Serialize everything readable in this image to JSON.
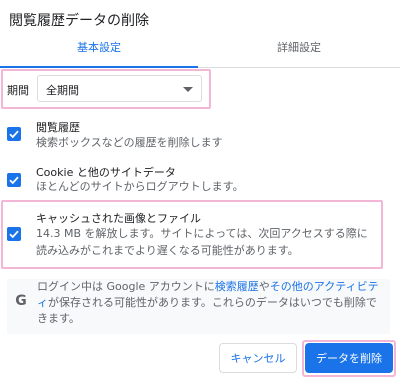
{
  "dialog": {
    "title": "閲覧履歴データの削除"
  },
  "tabs": [
    {
      "label": "基本設定",
      "active": true
    },
    {
      "label": "詳細設定",
      "active": false
    }
  ],
  "period": {
    "label": "期間",
    "selected": "全期間"
  },
  "options": [
    {
      "title": "閲覧履歴",
      "description": "検索ボックスなどの履歴を削除します",
      "checked": true
    },
    {
      "title": "Cookie と他のサイトデータ",
      "description": "ほとんどのサイトからログアウトします。",
      "checked": true
    },
    {
      "title": "キャッシュされた画像とファイル",
      "description": "14.3 MB を解放します。サイトによっては、次回アクセスする際に読み込みがこれまでより遅くなる可能性があります。",
      "checked": true
    }
  ],
  "info": {
    "icon": "google-g-icon",
    "text_before": "ログイン中は Google アカウントに",
    "link1": "検索履歴",
    "text_mid": "や",
    "link2": "その他のアクティビティ",
    "text_after": "が保存される可能性があります。これらのデータはいつでも削除できます。"
  },
  "buttons": {
    "cancel": "キャンセル",
    "delete": "データを削除"
  },
  "colors": {
    "accent": "#1a73e8",
    "highlight": "#f4b6d6"
  }
}
